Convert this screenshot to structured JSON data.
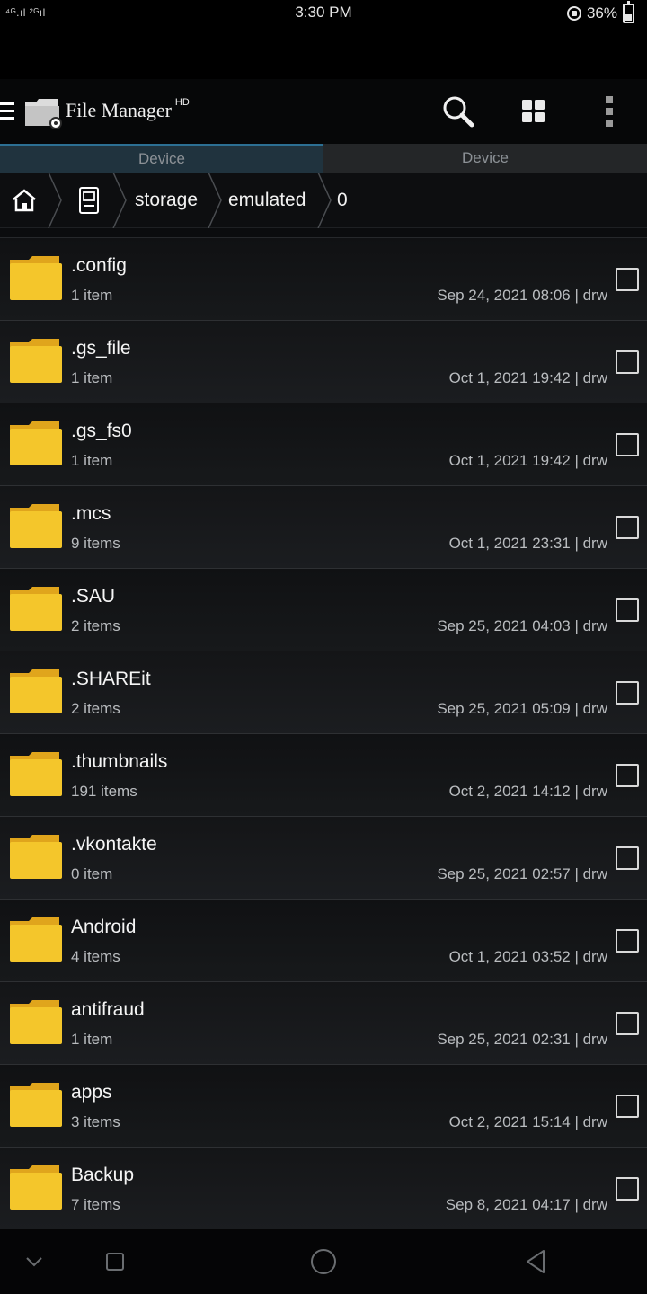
{
  "status_bar": {
    "signal_text_1": "⁴ᴳ",
    "signal_text_2": "²ᴳ",
    "time": "3:30 PM",
    "battery": "36%"
  },
  "app_bar": {
    "title": "File Manager",
    "title_suffix": "HD"
  },
  "tabs": [
    {
      "label": "Device",
      "active": true
    },
    {
      "label": "Device",
      "active": false
    }
  ],
  "breadcrumb": {
    "segments": [
      "storage",
      "emulated",
      "0"
    ]
  },
  "files": [
    {
      "name": ".config",
      "count": "1 item",
      "meta": "Sep 24, 2021 08:06 | drw"
    },
    {
      "name": ".gs_file",
      "count": "1 item",
      "meta": "Oct 1, 2021 19:42 | drw"
    },
    {
      "name": ".gs_fs0",
      "count": "1 item",
      "meta": "Oct 1, 2021 19:42 | drw"
    },
    {
      "name": ".mcs",
      "count": "9 items",
      "meta": "Oct 1, 2021 23:31 | drw"
    },
    {
      "name": ".SAU",
      "count": "2 items",
      "meta": "Sep 25, 2021 04:03 | drw"
    },
    {
      "name": ".SHAREit",
      "count": "2 items",
      "meta": "Sep 25, 2021 05:09 | drw"
    },
    {
      "name": ".thumbnails",
      "count": "191 items",
      "meta": "Oct 2, 2021 14:12 | drw"
    },
    {
      "name": ".vkontakte",
      "count": "0 item",
      "meta": "Sep 25, 2021 02:57 | drw"
    },
    {
      "name": "Android",
      "count": "4 items",
      "meta": "Oct 1, 2021 03:52 | drw"
    },
    {
      "name": "antifraud",
      "count": "1 item",
      "meta": "Sep 25, 2021 02:31 | drw"
    },
    {
      "name": "apps",
      "count": "3 items",
      "meta": "Oct 2, 2021 15:14 | drw"
    },
    {
      "name": "Backup",
      "count": "7 items",
      "meta": "Sep 8, 2021 04:17 | drw"
    }
  ],
  "colors": {
    "folder": "#f4c62b",
    "folder_tab": "#e0a51c",
    "tab_active_bg": "#20333e",
    "accent": "#2c6f93"
  },
  "icons": {
    "hamburger": "menu-icon",
    "logo": "folder-gear-icon",
    "search": "search-icon",
    "grid": "grid-view-icon",
    "more": "more-vertical-icon",
    "home": "home-icon",
    "device": "device-storage-icon",
    "folder": "folder-icon",
    "checkbox": "checkbox-icon",
    "nav_back": "back-triangle-icon",
    "nav_home": "home-circle-icon",
    "nav_recents": "recents-square-icon",
    "nav_down": "chevron-down-icon"
  }
}
